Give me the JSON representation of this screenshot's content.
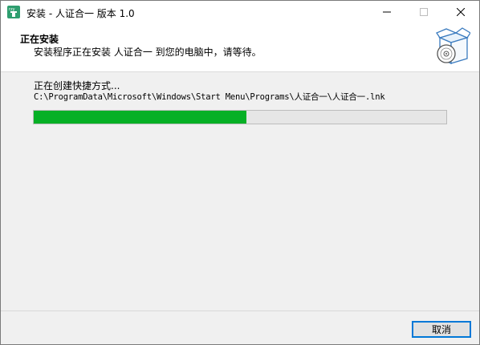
{
  "window": {
    "title": "安装 - 人证合一 版本 1.0",
    "icon": "installer-app-icon",
    "controls": {
      "minimize": "minimize-icon",
      "maximize": "maximize-icon",
      "close": "close-icon"
    }
  },
  "header": {
    "title": "正在安装",
    "subtitle": "安装程序正在安装 人证合一 到您的电脑中，请等待。",
    "image": "box-with-disc-icon"
  },
  "main": {
    "status": "正在创建快捷方式...",
    "path": "C:\\ProgramData\\Microsoft\\Windows\\Start Menu\\Programs\\人证合一\\人证合一.lnk",
    "progress": 0.515
  },
  "footer": {
    "cancel_label": "取消"
  },
  "colors": {
    "progress_fill": "#06b025",
    "button_focus_border": "#0078d7"
  }
}
